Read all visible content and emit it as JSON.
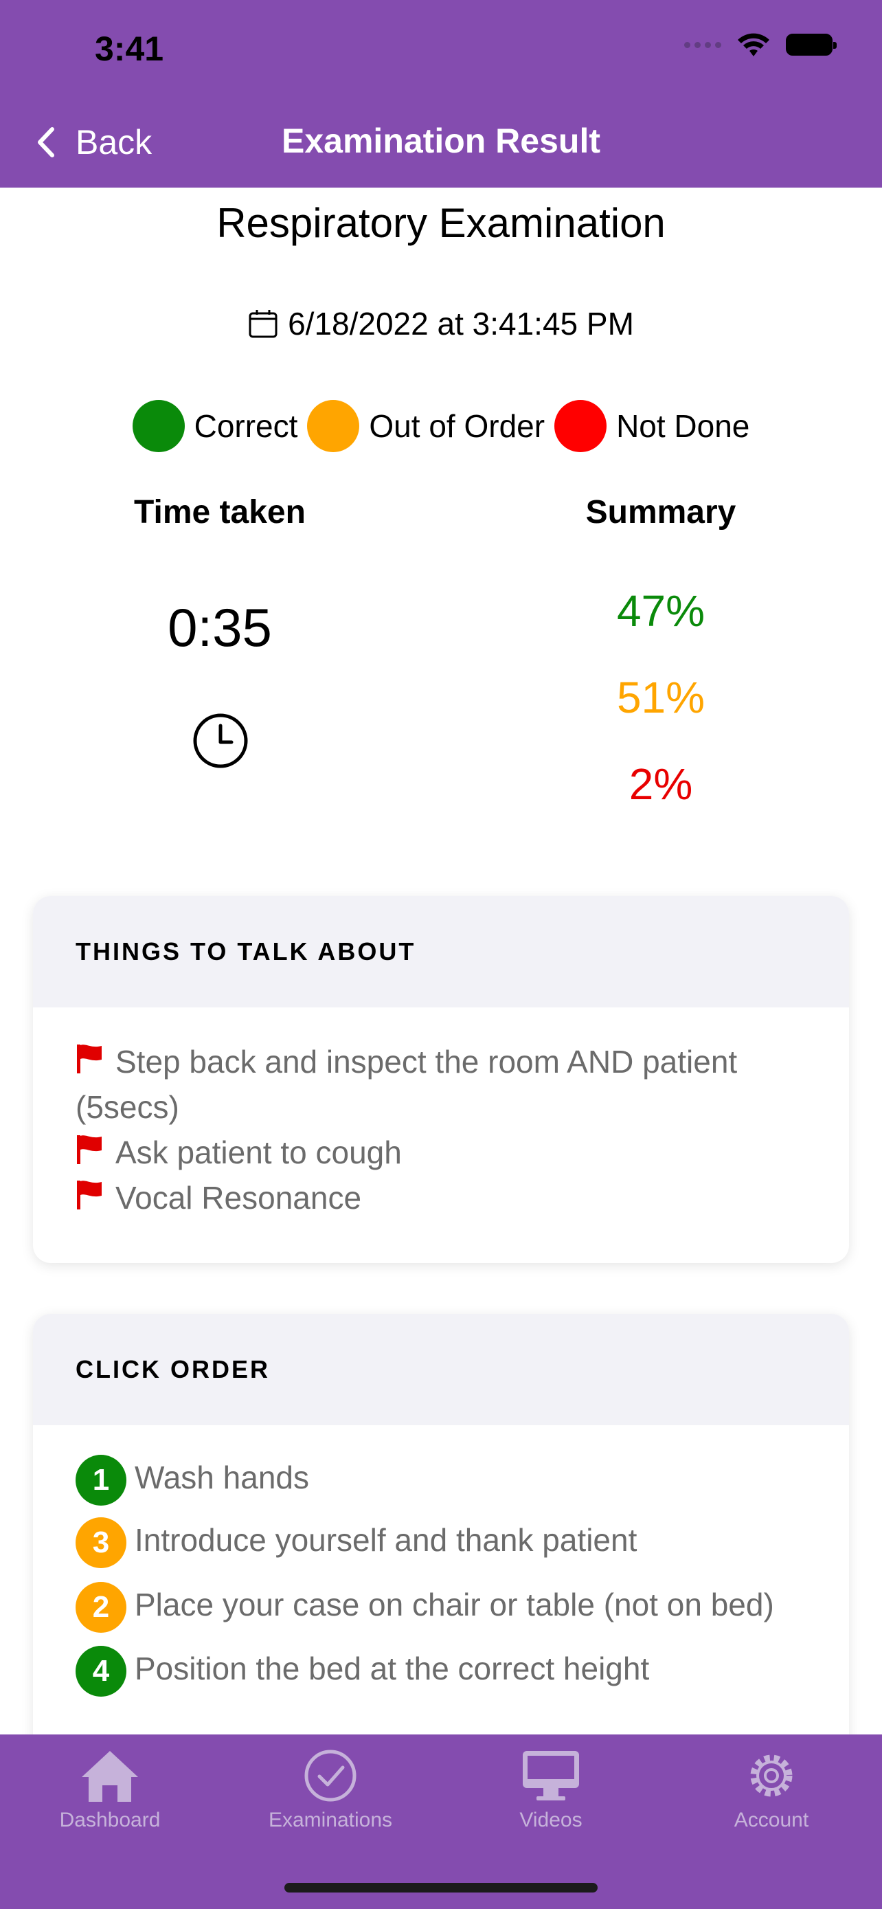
{
  "status_bar": {
    "time": "3:41"
  },
  "nav": {
    "back_label": "Back",
    "title": "Examination Result"
  },
  "exam": {
    "title": "Respiratory Examination",
    "date": "6/18/2022 at 3:41:45 PM"
  },
  "legend": [
    {
      "label": "Correct",
      "color": "#0a8a0a"
    },
    {
      "label": "Out of Order",
      "color": "#ffa500"
    },
    {
      "label": "Not Done",
      "color": "#ff0000"
    }
  ],
  "stats": {
    "time_heading": "Time taken",
    "time_value": "0:35",
    "summary_heading": "Summary",
    "correct_pct": "47%",
    "out_of_order_pct": "51%",
    "not_done_pct": "2%"
  },
  "talk_card": {
    "title": "THINGS TO TALK ABOUT",
    "items": [
      "Step back and inspect the room AND patient (5secs)",
      "Ask patient to cough",
      "Vocal Resonance"
    ]
  },
  "order_card": {
    "title": "CLICK ORDER",
    "items": [
      {
        "num": "1",
        "label": "Wash hands",
        "color": "#0a8a0a"
      },
      {
        "num": "3",
        "label": "Introduce yourself and thank patient",
        "color": "#ffa500"
      },
      {
        "num": "2",
        "label": "Place your case on chair or table (not on bed)",
        "color": "#ffa500"
      },
      {
        "num": "4",
        "label": "Position the bed at the correct height",
        "color": "#0a8a0a"
      }
    ]
  },
  "tabs": [
    {
      "label": "Dashboard",
      "icon": "home-icon"
    },
    {
      "label": "Examinations",
      "icon": "check-circle-icon"
    },
    {
      "label": "Videos",
      "icon": "monitor-icon"
    },
    {
      "label": "Account",
      "icon": "gear-icon"
    }
  ]
}
